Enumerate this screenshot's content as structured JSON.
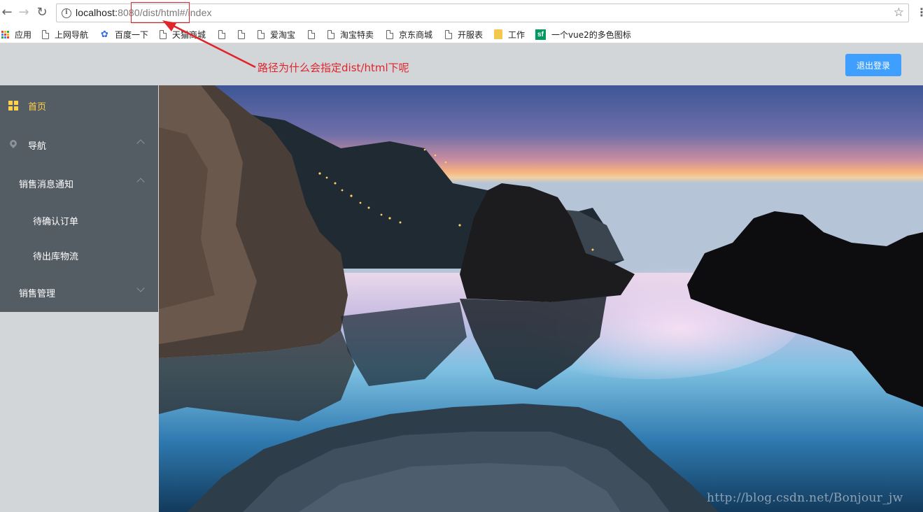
{
  "browser": {
    "url_host": "localhost:",
    "url_rest": "8080/dist/html#/index",
    "bookmarks": [
      {
        "label": "应用",
        "icon": "apps-grid-icon"
      },
      {
        "label": "上网导航",
        "icon": "page-icon"
      },
      {
        "label": "百度一下",
        "icon": "baidu-paw-icon"
      },
      {
        "label": "天猫商城",
        "icon": "page-icon"
      },
      {
        "label": "",
        "icon": "page-icon"
      },
      {
        "label": "",
        "icon": "page-icon"
      },
      {
        "label": "爱淘宝",
        "icon": "page-icon"
      },
      {
        "label": "",
        "icon": "page-icon"
      },
      {
        "label": "淘宝特卖",
        "icon": "page-icon"
      },
      {
        "label": "京东商城",
        "icon": "page-icon"
      },
      {
        "label": "开服表",
        "icon": "page-icon"
      },
      {
        "label": "工作",
        "icon": "folder-icon"
      },
      {
        "label": "一个vue2的多色图标",
        "icon": "sf-icon"
      }
    ]
  },
  "header": {
    "logout_label": "退出登录"
  },
  "sidebar": {
    "items": [
      {
        "label": "首页",
        "active": true
      },
      {
        "label": "导航",
        "expanded": true
      },
      {
        "label": "销售消息通知",
        "expanded": true
      },
      {
        "label": "待确认订单"
      },
      {
        "label": "待出库物流"
      },
      {
        "label": "销售管理",
        "expanded": false
      }
    ]
  },
  "annotation": {
    "text": "路径为什么会指定dist/html下呢"
  },
  "watermark": "http://blog.csdn.net/Bonjour_jw",
  "colors": {
    "menu_bg": "#545c64",
    "menu_active": "#ffd04b",
    "header_bg": "#d3d6d9",
    "button_primary": "#3e9fff",
    "annotation": "#e0242a"
  }
}
